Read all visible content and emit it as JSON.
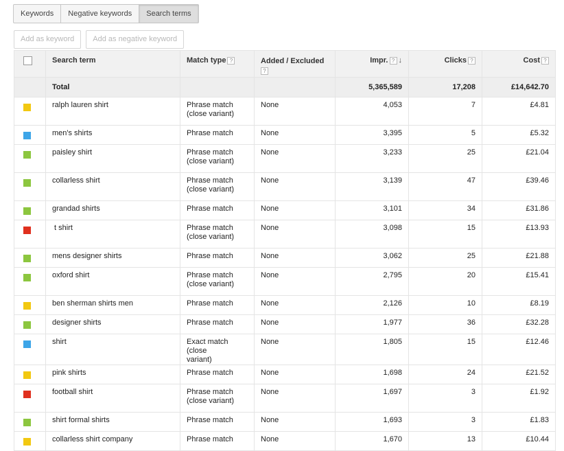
{
  "tabs": [
    {
      "label": "Keywords"
    },
    {
      "label": "Negative keywords"
    },
    {
      "label": "Search terms"
    }
  ],
  "actions": {
    "add_keyword": "Add as keyword",
    "add_negative_keyword": "Add as negative keyword"
  },
  "table": {
    "headers": {
      "search_term": "Search term",
      "match_type": "Match type",
      "added_excluded": "Added / Excluded",
      "impr": "Impr.",
      "clicks": "Clicks",
      "cost": "Cost"
    },
    "help_glyph": "?",
    "sort_glyph": "↓",
    "total": {
      "label": "Total",
      "impr": "5,365,589",
      "clicks": "17,208",
      "cost": "£14,642.70"
    },
    "rows": [
      {
        "color": "#f2c811",
        "term": "ralph lauren shirt",
        "match1": "Phrase match",
        "match2": "(close variant)",
        "added": "None",
        "impr": "4,053",
        "clicks": "7",
        "cost": "£4.81"
      },
      {
        "color": "#3da5e8",
        "term": "men's shirts",
        "match1": "Phrase match",
        "match2": "",
        "added": "None",
        "impr": "3,395",
        "clicks": "5",
        "cost": "£5.32"
      },
      {
        "color": "#8cc63f",
        "term": "paisley shirt",
        "match1": "Phrase match",
        "match2": "(close variant)",
        "added": "None",
        "impr": "3,233",
        "clicks": "25",
        "cost": "£21.04"
      },
      {
        "color": "#8cc63f",
        "term": "collarless shirt",
        "match1": "Phrase match",
        "match2": "(close variant)",
        "added": "None",
        "impr": "3,139",
        "clicks": "47",
        "cost": "£39.46"
      },
      {
        "color": "#8cc63f",
        "term": "grandad shirts",
        "match1": "Phrase match",
        "match2": "",
        "added": "None",
        "impr": "3,101",
        "clicks": "34",
        "cost": "£31.86"
      },
      {
        "color": "#e0301e",
        "term": " t shirt",
        "match1": "Phrase match",
        "match2": "(close variant)",
        "added": "None",
        "impr": "3,098",
        "clicks": "15",
        "cost": "£13.93"
      },
      {
        "color": "#8cc63f",
        "term": "mens designer shirts",
        "match1": "Phrase match",
        "match2": "",
        "added": "None",
        "impr": "3,062",
        "clicks": "25",
        "cost": "£21.88"
      },
      {
        "color": "#8cc63f",
        "term": "oxford shirt",
        "match1": "Phrase match",
        "match2": "(close variant)",
        "added": "None",
        "impr": "2,795",
        "clicks": "20",
        "cost": "£15.41"
      },
      {
        "color": "#f2c811",
        "term": "ben sherman shirts men",
        "match1": "Phrase match",
        "match2": "",
        "added": "None",
        "impr": "2,126",
        "clicks": "10",
        "cost": "£8.19"
      },
      {
        "color": "#8cc63f",
        "term": "designer shirts",
        "match1": "Phrase match",
        "match2": "",
        "added": "None",
        "impr": "1,977",
        "clicks": "36",
        "cost": "£32.28"
      },
      {
        "color": "#3da5e8",
        "term": "shirt",
        "match1": "Exact match (close",
        "match2": "variant)",
        "added": "None",
        "impr": "1,805",
        "clicks": "15",
        "cost": "£12.46"
      },
      {
        "color": "#f2c811",
        "term": "pink shirts",
        "match1": "Phrase match",
        "match2": "",
        "added": "None",
        "impr": "1,698",
        "clicks": "24",
        "cost": "£21.52"
      },
      {
        "color": "#e0301e",
        "term": "football shirt",
        "match1": "Phrase match",
        "match2": "(close variant)",
        "added": "None",
        "impr": "1,697",
        "clicks": "3",
        "cost": "£1.92"
      },
      {
        "color": "#8cc63f",
        "term": "shirt formal shirts",
        "match1": "Phrase match",
        "match2": "",
        "added": "None",
        "impr": "1,693",
        "clicks": "3",
        "cost": "£1.83"
      },
      {
        "color": "#f2c811",
        "term": "collarless shirt company",
        "match1": "Phrase match",
        "match2": "",
        "added": "None",
        "impr": "1,670",
        "clicks": "13",
        "cost": "£10.44"
      }
    ]
  }
}
